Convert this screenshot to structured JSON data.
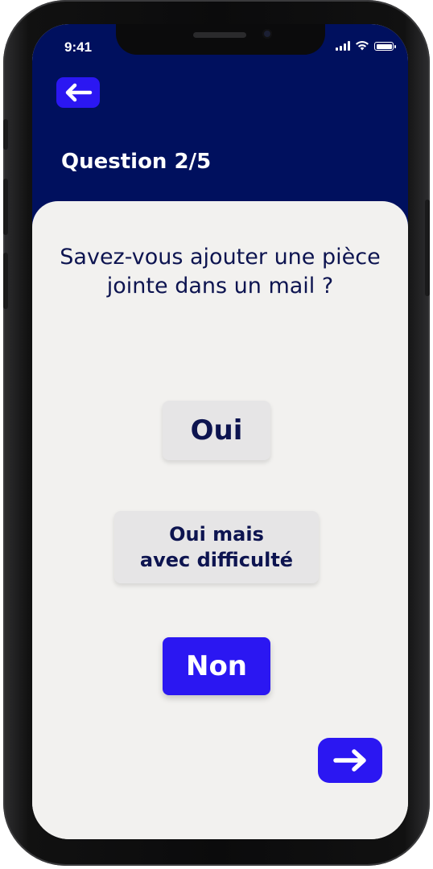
{
  "status_bar": {
    "time": "9:41"
  },
  "header": {
    "question_counter": "Question 2/5",
    "back_icon": "arrow-left-icon"
  },
  "question": {
    "text": "Savez-vous ajouter une pièce jointe dans un mail ?"
  },
  "answers": [
    {
      "label": "Oui",
      "selected": false
    },
    {
      "label": "Oui mais avec difficulté",
      "line1": "Oui mais",
      "line2": "avec difficulté",
      "selected": false
    },
    {
      "label": "Non",
      "selected": true
    }
  ],
  "footer": {
    "next_icon": "arrow-right-icon"
  },
  "colors": {
    "header_bg": "#00105e",
    "accent": "#2b17f2",
    "card_bg": "#f2f1ef",
    "text_dark": "#0d1450",
    "button_neutral": "#e6e5e6"
  }
}
